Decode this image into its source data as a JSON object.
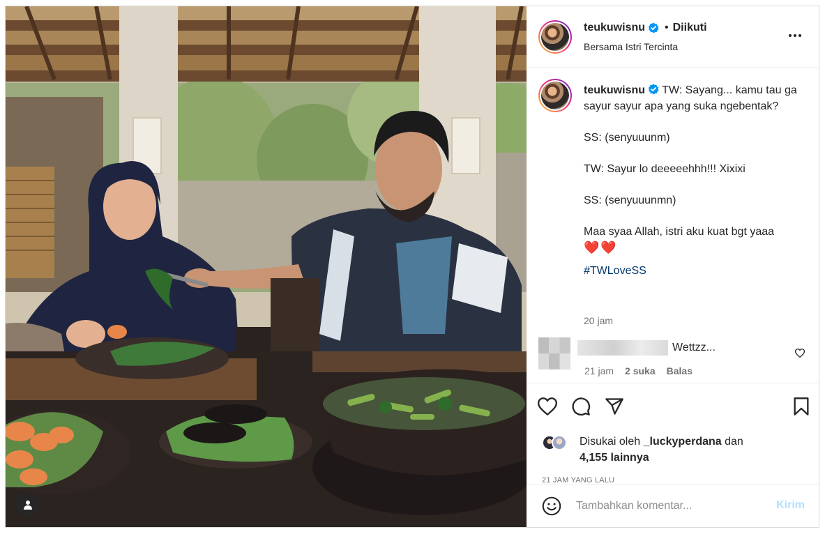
{
  "header": {
    "username": "teukuwisnu",
    "separator": "•",
    "follow_state": "Diikuti",
    "location": "Bersama Istri Tercinta"
  },
  "caption": {
    "username": "teukuwisnu",
    "lines": [
      "TW: Sayang... kamu tau ga sayur sayur apa yang suka ngebentak?",
      "SS: (senyuuunm)",
      "TW: Sayur lo deeeeehhh!!! Xixixi",
      "SS: (senyuuunmn)",
      "Maa syaa Allah, istri aku kuat bgt yaaa"
    ],
    "emoji": "❤️❤️",
    "hashtag": "#TWLoveSS",
    "time": "20 jam"
  },
  "comment": {
    "text": "Wettzz...",
    "time": "21 jam",
    "likes": "2 suka",
    "reply_label": "Balas"
  },
  "likes": {
    "prefix": "Disukai oleh",
    "liker": "_luckyperdana",
    "joiner": "dan",
    "others": "4,155 lainnya"
  },
  "time_ago": "21 JAM YANG LALU",
  "add_comment": {
    "placeholder": "Tambahkan komentar...",
    "post_label": "Kirim"
  },
  "icons": {
    "like": "heart-icon",
    "comment": "comment-icon",
    "share": "share-icon",
    "save": "bookmark-icon",
    "more": "more-options-icon",
    "emoji": "emoji-icon",
    "tag": "user-tag-icon"
  },
  "colors": {
    "verified": "#0095f6",
    "link": "#00376b",
    "muted": "#737373",
    "post_disabled": "#b2dffc"
  }
}
